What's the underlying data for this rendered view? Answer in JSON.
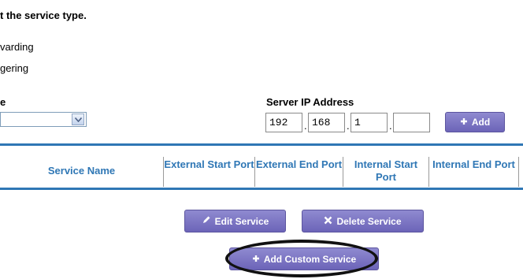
{
  "intro": {
    "text": "t the service type."
  },
  "service_types": [
    {
      "label": "varding"
    },
    {
      "label": "gering"
    }
  ],
  "form": {
    "service_label": "e",
    "server_ip_label": "Server IP Address",
    "ip": [
      "192",
      "168",
      "1",
      ""
    ],
    "add_label": "Add"
  },
  "table": {
    "headers": [
      "Service Name",
      "External Start Port",
      "External End Port",
      "Internal Start Port",
      "Internal End Port"
    ]
  },
  "actions": {
    "edit_label": "Edit Service",
    "delete_label": "Delete Service",
    "add_custom_label": "Add Custom Service"
  },
  "colors": {
    "header_blue": "#2f77b5",
    "button_purple": "#6c64b8",
    "annotation_oval": "#111111"
  }
}
